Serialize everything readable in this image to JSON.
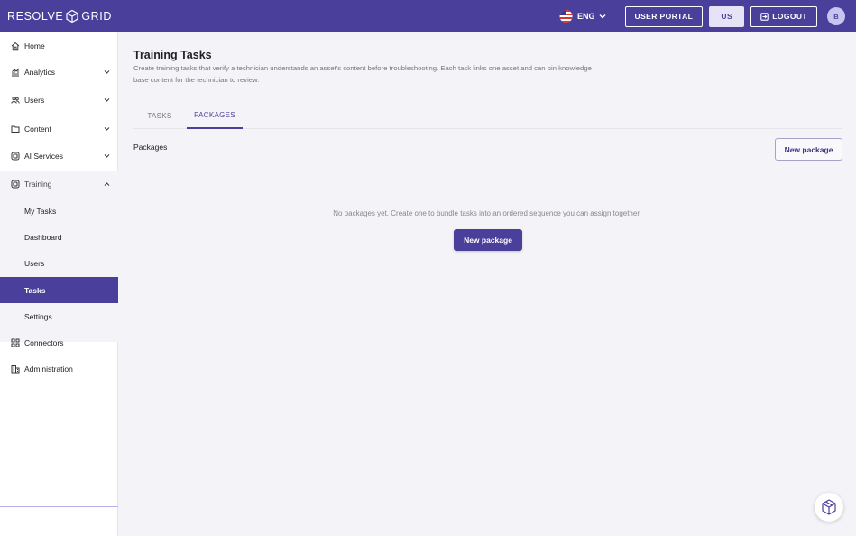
{
  "brand": {
    "name_left": "RESOLVE",
    "name_right": "GRID"
  },
  "topbar": {
    "language": "ENG",
    "user_portal_label": "USER PORTAL",
    "region_label": "US",
    "logout_label": "LOGOUT",
    "avatar_initial": "B"
  },
  "sidebar": {
    "items": [
      {
        "label": "Home",
        "icon": "home-icon"
      },
      {
        "label": "Analytics",
        "icon": "analytics-icon"
      },
      {
        "label": "Users",
        "icon": "users-icon"
      },
      {
        "label": "Content",
        "icon": "folder-icon"
      },
      {
        "label": "AI Services",
        "icon": "ai-services-icon"
      },
      {
        "label": "Training",
        "icon": "training-icon"
      },
      {
        "label": "Connectors",
        "icon": "connectors-icon"
      },
      {
        "label": "Administration",
        "icon": "administration-icon"
      }
    ],
    "training_sub": [
      {
        "label": "My Tasks"
      },
      {
        "label": "Dashboard"
      },
      {
        "label": "Users"
      },
      {
        "label": "Tasks"
      },
      {
        "label": "Settings"
      }
    ],
    "active_sub": "Tasks"
  },
  "page": {
    "title": "Training Tasks",
    "description": "Create training tasks that verify a technician understands an asset's content before troubleshooting. Each task links one asset and can pin knowledge base content for the technician to review.",
    "tabs": [
      {
        "label": "TASKS"
      },
      {
        "label": "PACKAGES"
      }
    ],
    "active_tab": "PACKAGES",
    "section_title": "Packages",
    "new_package_label": "New package",
    "empty_message": "No packages yet. Create one to bundle tasks into an ordered sequence you can assign together.",
    "empty_button_label": "New package"
  },
  "colors": {
    "brand": "#4a3f9b",
    "accent_light": "#e6e3f6",
    "background": "#f4f4f8"
  }
}
